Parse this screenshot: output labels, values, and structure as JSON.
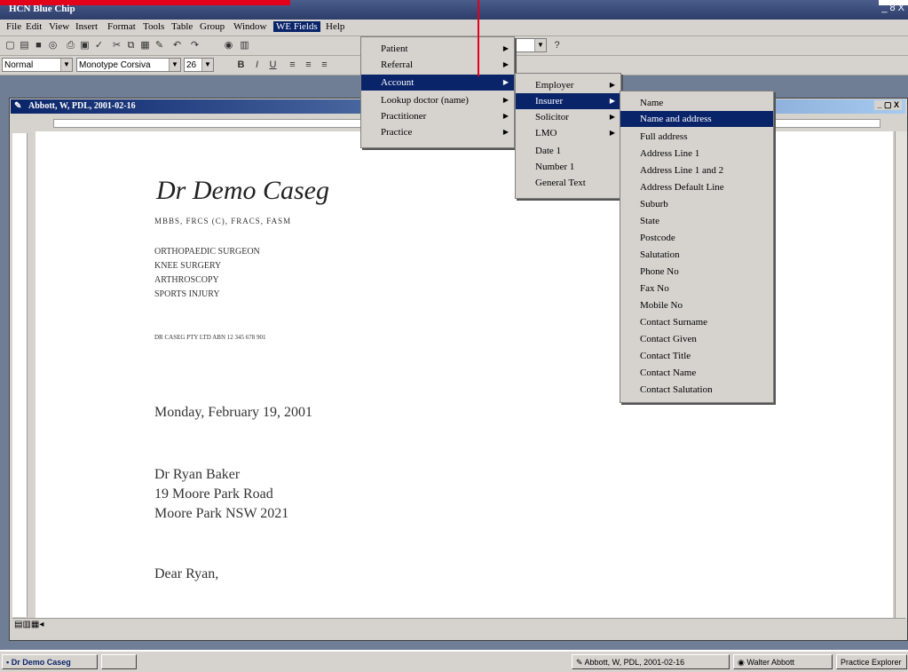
{
  "app": {
    "title": "HCN Blue Chip",
    "window_controls": "_ 8 X"
  },
  "menubar": {
    "items": [
      "File",
      "Edit",
      "View",
      "Insert",
      "Format",
      "Tools",
      "Table",
      "Group",
      "Window",
      "WE Fields",
      "Help"
    ],
    "active": "WE Fields"
  },
  "toolbar": {
    "style_value": "Normal",
    "font_value": "Monotype Corsiva",
    "size_value": "26",
    "bold": "B",
    "italic": "I",
    "underline": "U"
  },
  "document": {
    "title": "Abbott, W, PDL, 2001-02-16",
    "doctor_name": "Dr Demo Caseg",
    "qualifications": "MBBS, FRCS (C), FRACS, FASM",
    "specialties": [
      "ORTHOPAEDIC SURGEON",
      "KNEE SURGERY",
      "ARTHROSCOPY",
      "SPORTS INJURY"
    ],
    "company": "DR CASEG PTY LTD  ABN  12 345 678 901",
    "date": "Monday, February 19, 2001",
    "recipient": [
      "Dr Ryan Baker",
      "19 Moore Park Road",
      "Moore Park  NSW  2021"
    ],
    "salutation": "Dear Ryan,"
  },
  "menu_we_fields": {
    "items": [
      {
        "label": "Patient",
        "sub": true
      },
      {
        "label": "Referral",
        "sub": true
      },
      {
        "label": "Account",
        "sub": true
      },
      {
        "label": "Lookup doctor (name)",
        "sub": true
      },
      {
        "label": "Practitioner",
        "sub": true
      },
      {
        "label": "Practice",
        "sub": true
      }
    ],
    "selected": "Account"
  },
  "menu_account": {
    "items": [
      {
        "label": "Employer",
        "sub": true
      },
      {
        "label": "Insurer",
        "sub": true
      },
      {
        "label": "Solicitor",
        "sub": true
      },
      {
        "label": "LMO",
        "sub": true
      },
      {
        "label": "Date 1",
        "sub": false
      },
      {
        "label": "Number 1",
        "sub": false
      },
      {
        "label": "General Text",
        "sub": false
      }
    ],
    "selected": "Insurer"
  },
  "menu_insurer": {
    "items": [
      "Name",
      "Name and address",
      "Full address",
      "Address Line 1",
      "Address Line 1 and 2",
      "Address Default Line",
      "Suburb",
      "State",
      "Postcode",
      "Salutation",
      "Phone No",
      "Fax No",
      "Mobile No",
      "Contact Surname",
      "Contact Given",
      "Contact Title",
      "Contact Name",
      "Contact Salutation"
    ],
    "selected": "Name and address"
  },
  "taskbar": {
    "start": "Dr Demo Caseg",
    "buttons": [
      "Abbott, W, PDL, 2001-02-16",
      "Walter Abbott",
      "Practice Explorer"
    ]
  },
  "colors": {
    "accent_red": "#e2001a",
    "selection_blue": "#0a246a"
  }
}
